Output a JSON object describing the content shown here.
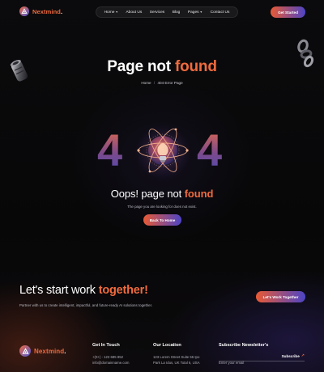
{
  "brand": {
    "name": "Nextmind",
    "dot": "."
  },
  "nav": {
    "items": [
      {
        "label": "Home",
        "has_dropdown": true
      },
      {
        "label": "About Us",
        "has_dropdown": false
      },
      {
        "label": "Services",
        "has_dropdown": false
      },
      {
        "label": "Blog",
        "has_dropdown": false
      },
      {
        "label": "Pages",
        "has_dropdown": true
      },
      {
        "label": "Contact Us",
        "has_dropdown": false
      }
    ],
    "dropdown_icon": "chevron-down-icon",
    "dropdown_glyph": "▼"
  },
  "header": {
    "cta_label": "Get Started"
  },
  "hero": {
    "title_prefix": "Page not ",
    "title_accent": "found",
    "breadcrumb_home": "Home",
    "breadcrumb_sep": "/",
    "breadcrumb_current": "404 Error Page"
  },
  "error": {
    "digit_left": "4",
    "digit_right": "4",
    "heading_prefix": "Oops! page not ",
    "heading_accent": "found",
    "subtext": "The page you are looking for does not exist.",
    "button_label": "Back To Home"
  },
  "cta": {
    "title_prefix": "Let's start work ",
    "title_accent": "together!",
    "description": "Partner with us to create intelligent, impactful, and future-ready AI solutions together.",
    "button_label": "Let's Work Together"
  },
  "footer": {
    "contact": {
      "title": "Get In Touch",
      "phone": "+(0+) - 123 685 852",
      "email": "info@domainname.com"
    },
    "location": {
      "title": "Our Location",
      "line1": "123 Lorem Street Suite 56 Ipo",
      "line2": "Park La Idus, UK Total 6, USA"
    },
    "newsletter": {
      "title": "Subscribe Newsletter's",
      "placeholder": "Enter your email",
      "button_label": "Subscribe",
      "button_arrow": "↗"
    }
  },
  "colors": {
    "accent": "#f06b3e",
    "accent_secondary": "#4d45c6",
    "background": "#060607"
  }
}
